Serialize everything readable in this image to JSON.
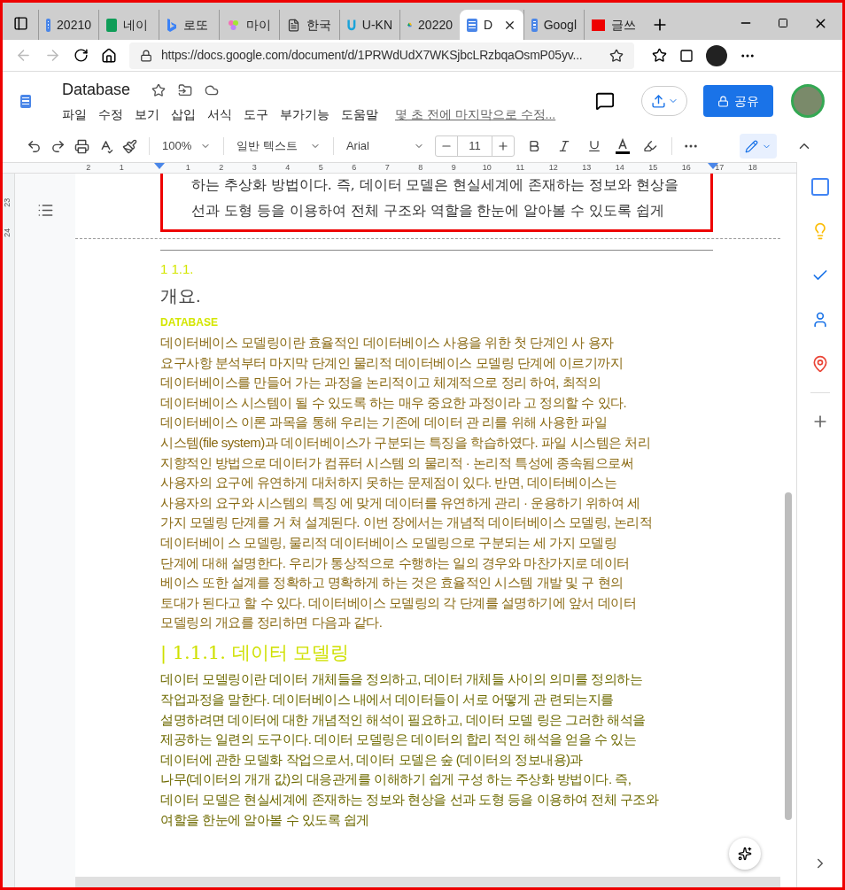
{
  "browser": {
    "tabs": [
      {
        "label": "20210",
        "selected": false,
        "kind": "doc"
      },
      {
        "label": "네이",
        "selected": false,
        "kind": "sheet"
      },
      {
        "label": "로또",
        "selected": false,
        "kind": "bing"
      },
      {
        "label": "마이",
        "selected": false,
        "kind": "flower"
      },
      {
        "label": "한국",
        "selected": false,
        "kind": "page"
      },
      {
        "label": "U-KN",
        "selected": false,
        "kind": "u"
      },
      {
        "label": "20220",
        "selected": false,
        "kind": "drive"
      },
      {
        "label": "D",
        "selected": true,
        "kind": "doc"
      },
      {
        "label": "Googl",
        "selected": false,
        "kind": "doc"
      },
      {
        "label": "글쓰",
        "selected": false,
        "kind": "red"
      }
    ],
    "url": "https://docs.google.com/document/d/1PRWdUdX7WKSjbcLRzbqaOsmP05yv..."
  },
  "doc": {
    "title": "Database",
    "menus": [
      "파일",
      "수정",
      "보기",
      "삽입",
      "서식",
      "도구",
      "부가기능",
      "도움말"
    ],
    "last_edit": "몇 초 전에 마지막으로 수정...",
    "share": "공유"
  },
  "toolbar": {
    "zoom": "100%",
    "style": "일반 텍스트",
    "font": "Arial",
    "size": "11"
  },
  "ruler": [
    "2",
    "1",
    "1",
    "2",
    "3",
    "4",
    "5",
    "6",
    "7",
    "8",
    "9",
    "10",
    "11",
    "12",
    "13",
    "14",
    "15",
    "16",
    "17",
    "18"
  ],
  "vertical_ruler": [
    "23",
    "24"
  ],
  "embedded_image": {
    "lines": [
      "하는 추상화 방법이다. 즉, 데이터 모델은 현실세계에 존재하는 정보와 현상을",
      "선과 도형 등을 이용하여 전체 구조와 역할을 한눈에 알아볼 수 있도록 쉽게"
    ]
  },
  "content": [
    {
      "kind": "number",
      "text": "1 1.1."
    },
    {
      "kind": "title",
      "text": "개요."
    },
    {
      "kind": "label",
      "text": "DATABASE"
    },
    {
      "kind": "para",
      "color": "#8a6a14",
      "lines": [
        "데이터베이스 모델링이란 효율적인 데이터베이스 사용을 위한 첫 단계인 사 용자",
        "요구사항 분석부터 마지막 단계인 물리적 데이터베이스 모델링 단계에 이르기까지",
        "데이터베이스를 만들어 가는 과정을 논리적이고 체계적으로 정리 하여, 최적의",
        "데이터베이스 시스템이 될 수 있도록 하는 매우 중요한 과정이라 고 정의할 수 있다.",
        "데이터베이스 이론 과목을 통해 우리는 기존에 데이터 관 리를 위해 사용한 파일",
        "시스템(file system)과 데이터베이스가 구분되는 특징을 학습하였다. 파일 시스템은 처리",
        "지향적인 방법으로 데이터가 컴퓨터 시스템 의 물리적 · 논리적 특성에 종속됨으로써",
        "사용자의 요구에 유연하게 대처하지 못하는 문제점이 있다. 반면, 데이터베이스는",
        "사용자의 요구와 시스템의 특징 에 맞게 데이터를 유연하게 관리 · 운용하기 위하여 세",
        "가지 모델링 단계를 거 쳐 설계된다. 이번 장에서는 개념적 데이터베이스 모델링, 논리적",
        "데이터베이 스 모델링, 물리적 데이터베이스 모델링으로 구분되는 세 가지 모델링",
        "단계에 대해 설명한다. 우리가 통상적으로 수행하는 일의 경우와 마찬가지로 데이터",
        "베이스 또한 설계를 정확하고 명확하게 하는 것은 효율적인 시스템 개발 및 구 현의",
        "토대가 된다고 할 수 있다. 데이터베이스 모델링의 각 단계를 설명하기에 앞서 데이터",
        "모델링의 개요를 정리하면 다음과 같다."
      ]
    },
    {
      "kind": "heading",
      "text": "| 1.1.1. 데이터 모델링"
    },
    {
      "kind": "para",
      "color": "#6e6a00",
      "lines": [
        "데이터 모델링이란 데이터 개체들을 정의하고, 데이터 개체들 사이의 의미를 정의하는",
        "작업과정을 말한다. 데이터베이스 내에서 데이터들이 서로 어떻게 관 련되는지를",
        "설명하려면 데이터에 대한 개념적인 해석이 필요하고, 데이터 모델 링은 그러한 해석을",
        "제공하는 일련의 도구이다. 데이터 모델링은 데이터의 합리 적인 해석을 얻을 수 있는",
        "데이터에 관한 모델화 작업으로서, 데이터 모델은 숲 (데이터의 정보내용)과",
        "나무(데이터의 개개 값)의 대응관게를 이해하기 쉽게 구성 하는 주상화 방법이다. 즉,",
        "데이터 모델은 현실세계에 존재하는 정보와 현상을 선과 도형 등을 이용하여 전체 구조와",
        "여할을 한눈에 알아볼 수 있도록 쉽게"
      ]
    }
  ]
}
